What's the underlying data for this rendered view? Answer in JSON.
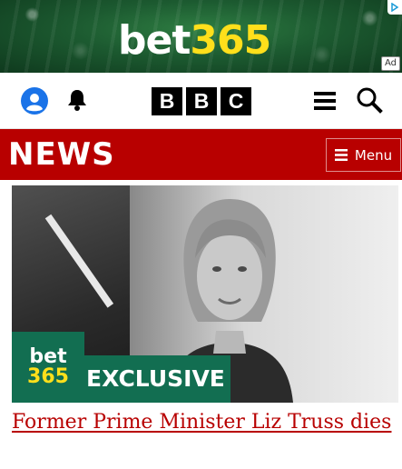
{
  "ad": {
    "brand_white": "bet",
    "brand_yellow": "365",
    "tag": "Ad",
    "brand_color": "#126e51",
    "accent_color": "#ffdf1b"
  },
  "header": {
    "logo_letters": [
      "B",
      "B",
      "C"
    ],
    "icons": [
      "account-icon",
      "bell-icon",
      "menu-icon",
      "search-icon"
    ]
  },
  "news_bar": {
    "title": "NEWS",
    "menu_label": "Menu",
    "color": "#b80000"
  },
  "article": {
    "badge_line1": "bet",
    "badge_line2": "365",
    "badge_label": "EXCLUSIVE",
    "headline": "Former Prime Minister Liz Truss dies"
  }
}
